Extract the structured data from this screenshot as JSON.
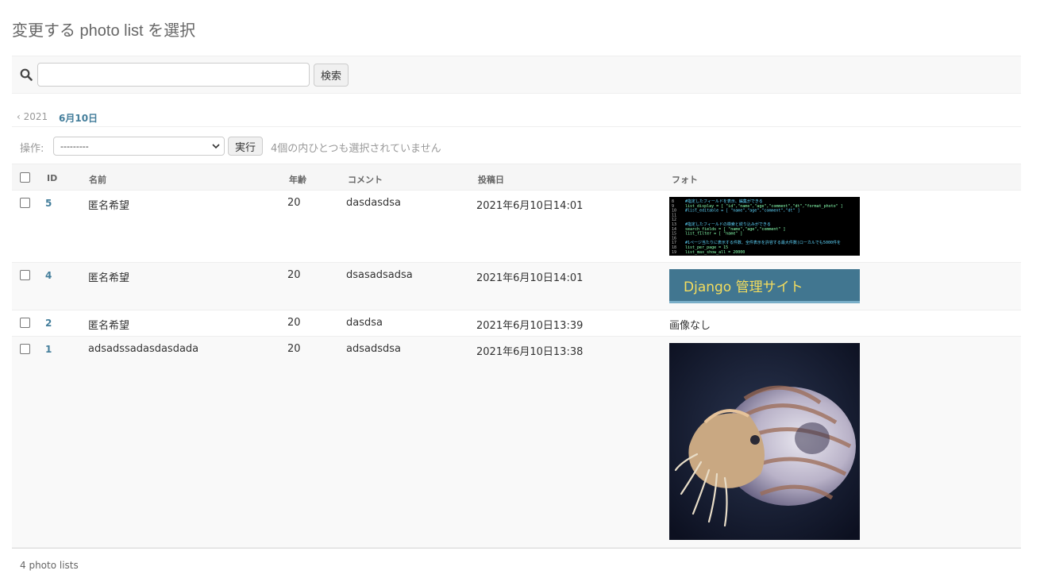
{
  "page": {
    "title": "変更する photo list を選択"
  },
  "search": {
    "value": "",
    "button_label": "検索"
  },
  "date_hierarchy": {
    "back_label": "‹ 2021",
    "current_label": "6月10日"
  },
  "actions": {
    "label": "操作:",
    "selected_option": "---------",
    "go_label": "実行",
    "counter_text": "4個の内ひとつも選択されていません"
  },
  "table": {
    "columns": [
      "ID",
      "名前",
      "年齢",
      "コメント",
      "投稿日",
      "フォト"
    ],
    "rows": [
      {
        "id": "5",
        "name": "匿名希望",
        "age": "20",
        "comment": "dasdasdsa",
        "date": "2021年6月10日14:01",
        "photo": "code-screenshot"
      },
      {
        "id": "4",
        "name": "匿名希望",
        "age": "20",
        "comment": "dsasadsadsa",
        "date": "2021年6月10日14:01",
        "photo": "django-banner"
      },
      {
        "id": "2",
        "name": "匿名希望",
        "age": "20",
        "comment": "dasdsa",
        "date": "2021年6月10日13:39",
        "photo_text": "画像なし"
      },
      {
        "id": "1",
        "name": "adsadssadasdasdada",
        "age": "20",
        "comment": "adsadsdsa",
        "date": "2021年6月10日13:38",
        "photo": "nautilus-photo"
      }
    ]
  },
  "code_image": {
    "line_numbers": [
      "8",
      "9",
      "10",
      "11",
      "12",
      "13",
      "14",
      "15",
      "16",
      "17",
      "18",
      "19"
    ],
    "lines": [
      "#指定したフィールドを表示、編集ができる",
      "list_display     = [ \"id\",\"name\",\"age\",\"comment\",\"dt\",\"format_photo\" ]",
      "#list_editable     = [ \"name\",\"age\",\"comment\",\"dt\" ]",
      "",
      "",
      "#指定したフィールドの検索と絞り込みができる",
      "search_fields     = [ \"name\",\"age\",\"comment\" ]",
      "list_filter       = [ \"name\" ]",
      "",
      "#1ページ当たりに表示する件数、全件表示を許容する最大件数(ローカルでも5000件を",
      "list_per_page     = 15",
      "list_max_show_all   = 20000"
    ]
  },
  "banner_image": {
    "text": "Django 管理サイト"
  },
  "footer": {
    "count_text": "4 photo lists"
  },
  "colors": {
    "link": "#447e9b",
    "banner_bg": "#417690",
    "banner_text": "#f5dd5d"
  }
}
